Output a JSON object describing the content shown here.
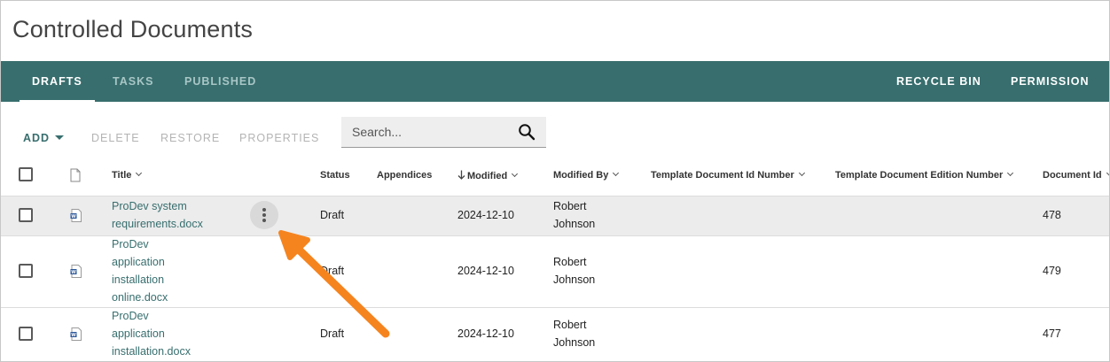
{
  "page": {
    "title": "Controlled Documents"
  },
  "tabs": {
    "left": [
      {
        "label": "DRAFTS",
        "active": true
      },
      {
        "label": "TASKS",
        "active": false
      },
      {
        "label": "PUBLISHED",
        "active": false
      }
    ],
    "right": [
      {
        "label": "RECYCLE BIN"
      },
      {
        "label": "PERMISSION"
      }
    ]
  },
  "toolbar": {
    "add_label": "ADD",
    "delete_label": "DELETE",
    "restore_label": "RESTORE",
    "properties_label": "PROPERTIES"
  },
  "search": {
    "placeholder": "Search...",
    "value": ""
  },
  "columns": {
    "title": "Title",
    "status": "Status",
    "appendices": "Appendices",
    "modified": "Modified",
    "modified_by": "Modified By",
    "template_id": "Template Document Id Number",
    "template_edition": "Template Document Edition Number",
    "document_id": "Document Id"
  },
  "rows": [
    {
      "title_lines": [
        "ProDev system",
        "requirements.docx"
      ],
      "status": "Draft",
      "modified": "2024-12-10",
      "modified_by_lines": [
        "Robert",
        "Johnson"
      ],
      "document_id": "478",
      "highlighted": true
    },
    {
      "title_lines": [
        "ProDev",
        "application",
        "installation",
        "online.docx"
      ],
      "status": "Draft",
      "modified": "2024-12-10",
      "modified_by_lines": [
        "Robert",
        "Johnson"
      ],
      "document_id": "479",
      "highlighted": false
    },
    {
      "title_lines": [
        "ProDev",
        "application",
        "installation.docx"
      ],
      "status": "Draft",
      "modified": "2024-12-10",
      "modified_by_lines": [
        "Robert",
        "Johnson"
      ],
      "document_id": "477",
      "highlighted": false
    }
  ],
  "colors": {
    "accent": "#386e6e",
    "annotation_arrow": "#f5841f",
    "word_icon": "#2b579a"
  },
  "icons": {
    "file_header": "file-icon",
    "row_file": "word-document-icon",
    "search": "search-icon",
    "more": "more-vertical-icon",
    "sort_desc": "arrow-down-icon"
  }
}
